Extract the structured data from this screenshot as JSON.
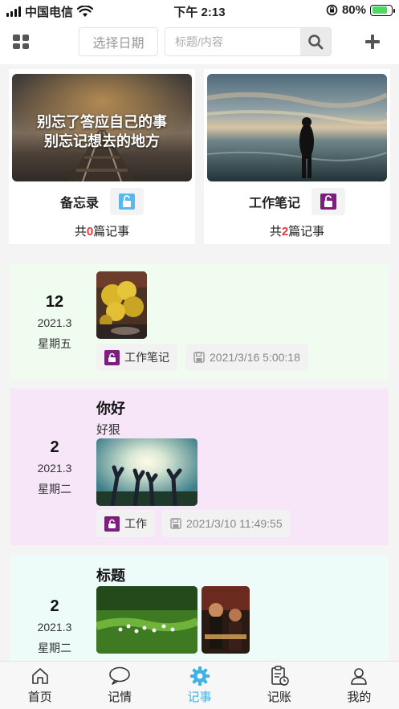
{
  "status_bar": {
    "carrier": "中国电信",
    "time": "下午 2:13",
    "battery_text": "80%",
    "battery_level": 0.8
  },
  "toolbar": {
    "date_placeholder": "选择日期",
    "search_placeholder": "标题/内容"
  },
  "notebooks": [
    {
      "name": "备忘录",
      "cover_quote_line1": "别忘了答应自己的事",
      "cover_quote_line2": "别忘记想去的地方",
      "count_prefix": "共",
      "count": "0",
      "count_suffix": "篇记事",
      "lock_color": "#5bb8ef"
    },
    {
      "name": "工作笔记",
      "count_prefix": "共",
      "count": "2",
      "count_suffix": "篇记事",
      "lock_color": "#7b1e7e"
    }
  ],
  "entries": [
    {
      "day": "12",
      "year_month": "2021.3",
      "weekday": "星期五",
      "notebook": "工作笔记",
      "timestamp": "2021/3/16 5:00:18",
      "bg_color": "#f0fcef"
    },
    {
      "day": "2",
      "year_month": "2021.3",
      "weekday": "星期二",
      "title": "你好",
      "body": "好狠",
      "notebook": "工作",
      "timestamp": "2021/3/10 11:49:55",
      "bg_color": "#f6e6f8"
    },
    {
      "day": "2",
      "year_month": "2021.3",
      "weekday": "星期二",
      "title": "标题",
      "bg_color": "#eefcf9"
    }
  ],
  "tabs": [
    {
      "label": "首页",
      "icon": "home-icon"
    },
    {
      "label": "记情",
      "icon": "chat-bubble-icon"
    },
    {
      "label": "记事",
      "icon": "gear-icon",
      "active": true
    },
    {
      "label": "记账",
      "icon": "clipboard-clock-icon"
    },
    {
      "label": "我的",
      "icon": "person-icon"
    }
  ],
  "colors": {
    "accent": "#3db1e8",
    "count_red": "#e53935",
    "lock_purple": "#7b1e7e",
    "lock_blue": "#5bb8ef"
  }
}
